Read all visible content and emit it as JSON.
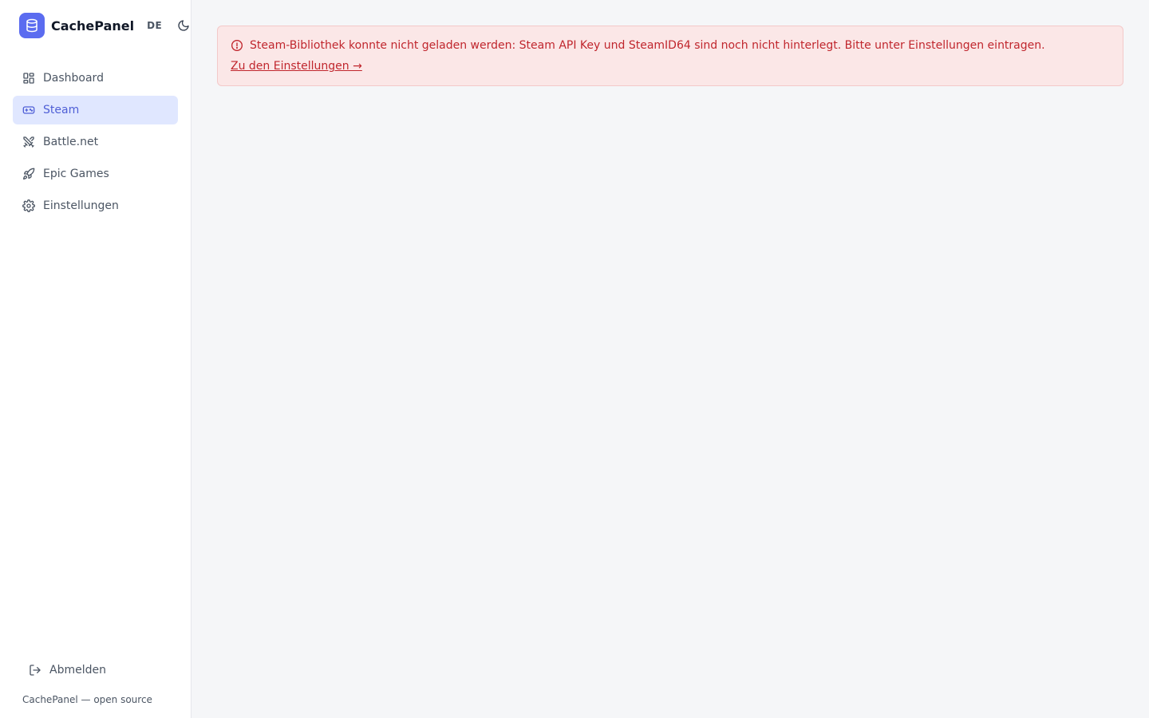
{
  "brand": {
    "name": "CachePanel",
    "language": "DE",
    "accent_color": "#5b6cf0",
    "logo_icon": "database-icon"
  },
  "nav": {
    "items": [
      {
        "label": "Dashboard",
        "icon": "dashboard-grid-icon",
        "active": false
      },
      {
        "label": "Steam",
        "icon": "gamepad-icon",
        "active": true
      },
      {
        "label": "Battle.net",
        "icon": "crossed-swords-icon",
        "active": false
      },
      {
        "label": "Epic Games",
        "icon": "rocket-icon",
        "active": false
      },
      {
        "label": "Einstellungen",
        "icon": "gear-icon",
        "active": false
      }
    ]
  },
  "footer": {
    "logout_label": "Abmelden",
    "note": "CachePanel — open source"
  },
  "alert": {
    "message": "Steam-Bibliothek konnte nicht geladen werden: Steam API Key und SteamID64 sind noch nicht hinterlegt. Bitte unter Einstellungen eintragen.",
    "link_label": "Zu den Einstellungen →",
    "color": "#c0262d",
    "background": "#fbe7e7"
  }
}
